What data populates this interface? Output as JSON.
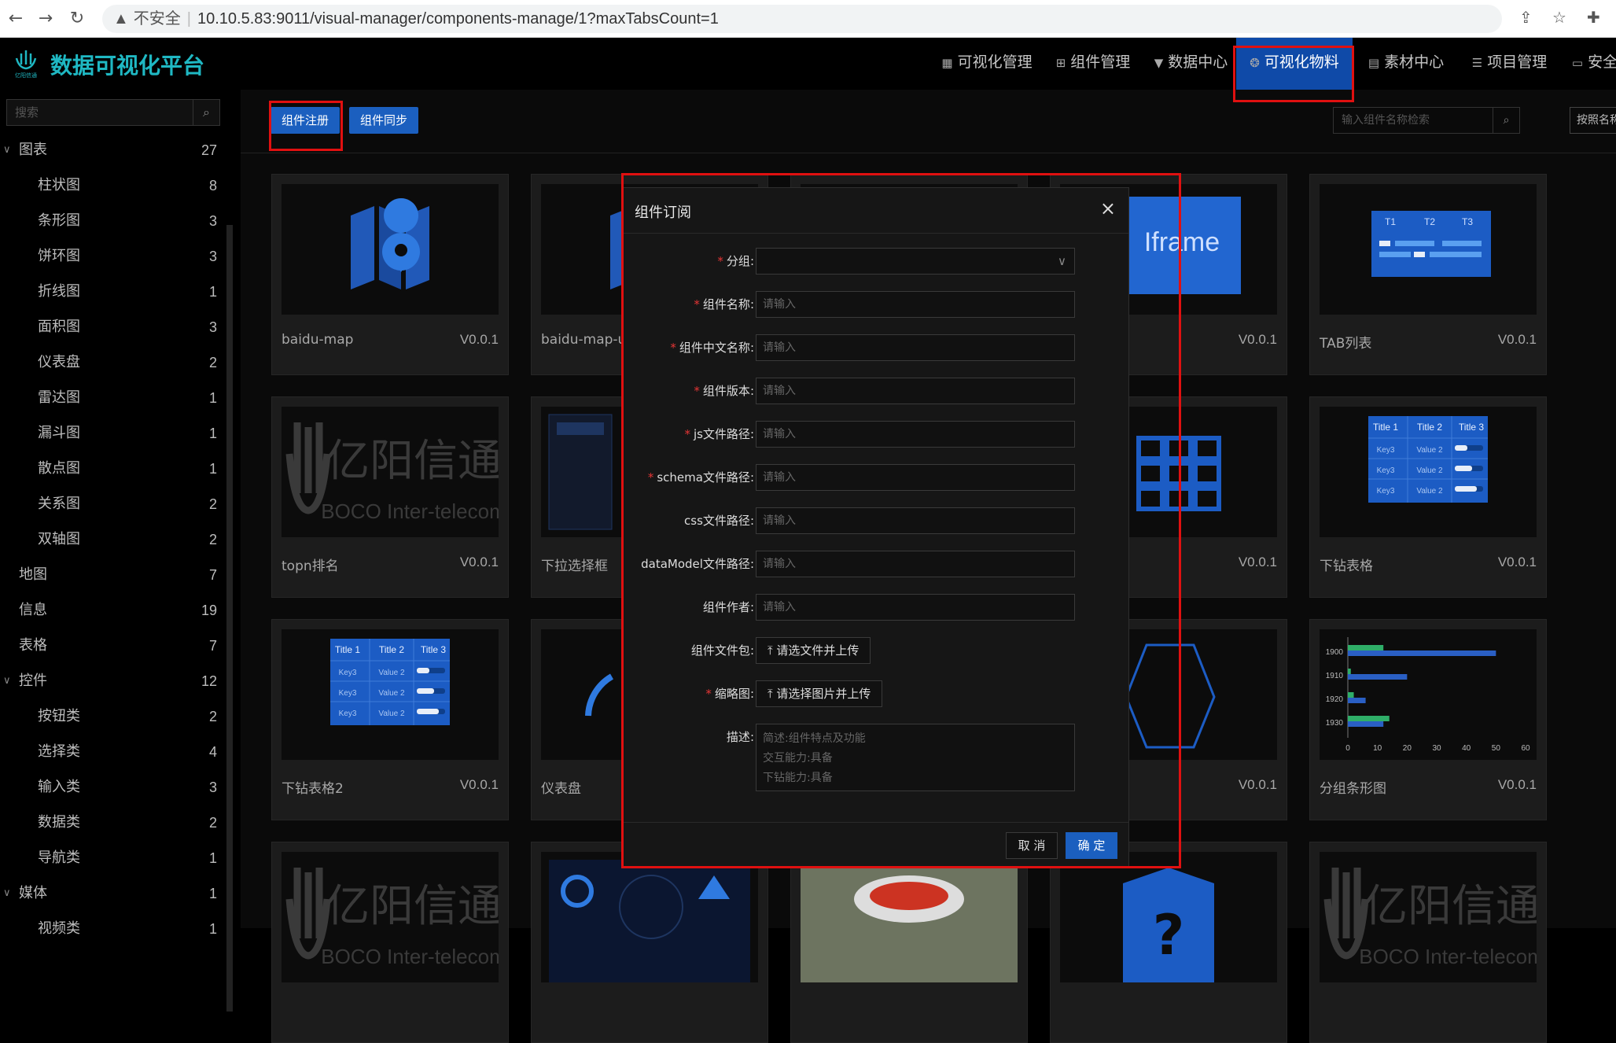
{
  "browser": {
    "insecure": "不安全",
    "url": "10.10.5.83:9011/visual-manager/components-manage/1?maxTabsCount=1"
  },
  "app": {
    "title": "数据可视化平台",
    "logo_caption": "亿阳信通"
  },
  "nav": [
    {
      "label": "可视化管理",
      "icon": "dashboard-icon"
    },
    {
      "label": "组件管理",
      "icon": "hierarchy-icon"
    },
    {
      "label": "数据中心",
      "icon": "filter-icon"
    },
    {
      "label": "可视化物料",
      "icon": "palette-icon",
      "active": true
    },
    {
      "label": "素材中心",
      "icon": "image-icon"
    },
    {
      "label": "项目管理",
      "icon": "list-icon"
    },
    {
      "label": "安全",
      "icon": "monitor-icon"
    }
  ],
  "sidebar": {
    "search_placeholder": "搜索",
    "items": [
      {
        "label": "图表",
        "count": "27",
        "level": 0,
        "expanded": true
      },
      {
        "label": "柱状图",
        "count": "8",
        "level": 1
      },
      {
        "label": "条形图",
        "count": "3",
        "level": 1
      },
      {
        "label": "饼环图",
        "count": "3",
        "level": 1
      },
      {
        "label": "折线图",
        "count": "1",
        "level": 1
      },
      {
        "label": "面积图",
        "count": "3",
        "level": 1
      },
      {
        "label": "仪表盘",
        "count": "2",
        "level": 1
      },
      {
        "label": "雷达图",
        "count": "1",
        "level": 1
      },
      {
        "label": "漏斗图",
        "count": "1",
        "level": 1
      },
      {
        "label": "散点图",
        "count": "1",
        "level": 1
      },
      {
        "label": "关系图",
        "count": "2",
        "level": 1
      },
      {
        "label": "双轴图",
        "count": "2",
        "level": 1
      },
      {
        "label": "地图",
        "count": "7",
        "level": 0
      },
      {
        "label": "信息",
        "count": "19",
        "level": 0
      },
      {
        "label": "表格",
        "count": "7",
        "level": 0
      },
      {
        "label": "控件",
        "count": "12",
        "level": 0,
        "expanded": true
      },
      {
        "label": "按钮类",
        "count": "2",
        "level": 1
      },
      {
        "label": "选择类",
        "count": "4",
        "level": 1
      },
      {
        "label": "输入类",
        "count": "3",
        "level": 1
      },
      {
        "label": "数据类",
        "count": "2",
        "level": 1
      },
      {
        "label": "导航类",
        "count": "1",
        "level": 1
      },
      {
        "label": "媒体",
        "count": "1",
        "level": 0,
        "expanded": true
      },
      {
        "label": "视频类",
        "count": "1",
        "level": 1
      }
    ]
  },
  "toolbar": {
    "register": "组件注册",
    "sync": "组件同步",
    "search_placeholder": "输入组件名称检索",
    "sort": "按照名称"
  },
  "cards": [
    {
      "name": "baidu-map",
      "version": "V0.0.1",
      "thumb": "map"
    },
    {
      "name": "baidu-map-u",
      "version": "",
      "thumb": "map"
    },
    {
      "name": "",
      "version": "",
      "thumb": "blank"
    },
    {
      "name": "",
      "version": "V0.0.1",
      "thumb": "iframe"
    },
    {
      "name": "TAB列表",
      "version": "V0.0.1",
      "thumb": "tabs"
    },
    {
      "name": "topn排名",
      "version": "V0.0.1",
      "thumb": "logo"
    },
    {
      "name": "下拉选择框",
      "version": "",
      "thumb": "dark"
    },
    {
      "name": "",
      "version": "",
      "thumb": "blank"
    },
    {
      "name": "",
      "version": "V0.0.1",
      "thumb": "grid"
    },
    {
      "name": "下钻表格",
      "version": "V0.0.1",
      "thumb": "table"
    },
    {
      "name": "下钻表格2",
      "version": "V0.0.1",
      "thumb": "table"
    },
    {
      "name": "仪表盘",
      "version": "",
      "thumb": "gauge"
    },
    {
      "name": "",
      "version": "",
      "thumb": "blank"
    },
    {
      "name": "",
      "version": "V0.0.1",
      "thumb": "hex"
    },
    {
      "name": "分组条形图",
      "version": "V0.0.1",
      "thumb": "barchart"
    },
    {
      "name": "",
      "version": "",
      "thumb": "logo"
    },
    {
      "name": "",
      "version": "",
      "thumb": "dashboard"
    },
    {
      "name": "",
      "version": "",
      "thumb": "stadium"
    },
    {
      "name": "",
      "version": "",
      "thumb": "question"
    },
    {
      "name": "",
      "version": "",
      "thumb": "logo"
    }
  ],
  "thumb_text": {
    "iframe": "Iframe",
    "logo_cn": "亿阳信通",
    "logo_en": "BOCO Inter-telecom",
    "tabs": [
      "T1",
      "T2",
      "T3"
    ],
    "table_head": [
      "Title 1",
      "Title 2",
      "Title 3"
    ],
    "table_rows": [
      [
        "Key3",
        "Value 2"
      ],
      [
        "Key3",
        "Value 2"
      ],
      [
        "Key3",
        "Value 2"
      ]
    ],
    "question": "?"
  },
  "bar_thumb": {
    "categories": [
      "1900",
      "1910",
      "1920",
      "1930"
    ],
    "ticks": [
      "0",
      "10",
      "20",
      "30",
      "40",
      "50",
      "60"
    ],
    "blue": [
      50,
      20,
      6,
      12
    ],
    "green": [
      12,
      1,
      2,
      14
    ],
    "xmax": 60
  },
  "modal": {
    "title": "组件订阅",
    "close": "×",
    "fields": [
      {
        "label": "分组",
        "required": true,
        "type": "select",
        "value": ""
      },
      {
        "label": "组件名称",
        "required": true,
        "type": "input",
        "placeholder": "请输入"
      },
      {
        "label": "组件中文名称",
        "required": true,
        "type": "input",
        "placeholder": "请输入"
      },
      {
        "label": "组件版本",
        "required": true,
        "type": "input",
        "placeholder": "请输入"
      },
      {
        "label": "js文件路径",
        "required": true,
        "type": "input",
        "placeholder": "请输入"
      },
      {
        "label": "schema文件路径",
        "required": true,
        "type": "input",
        "placeholder": "请输入"
      },
      {
        "label": "css文件路径",
        "required": false,
        "type": "input",
        "placeholder": "请输入"
      },
      {
        "label": "dataModel文件路径",
        "required": false,
        "type": "input",
        "placeholder": "请输入"
      },
      {
        "label": "组件作者",
        "required": false,
        "type": "input",
        "placeholder": "请输入"
      },
      {
        "label": "组件文件包",
        "required": false,
        "type": "upload",
        "button": "请选文件并上传"
      },
      {
        "label": "缩略图",
        "required": true,
        "type": "upload",
        "button": "请选择图片并上传"
      },
      {
        "label": "描述",
        "required": false,
        "type": "textarea",
        "placeholder": "简述:组件特点及功能\n交互能力:具备\n下钻能力:具备"
      }
    ],
    "cancel": "取 消",
    "ok": "确 定"
  },
  "colors": {
    "accent": "#1b5fbf",
    "brand": "#1fb8c3",
    "highlight": "#e01010"
  }
}
